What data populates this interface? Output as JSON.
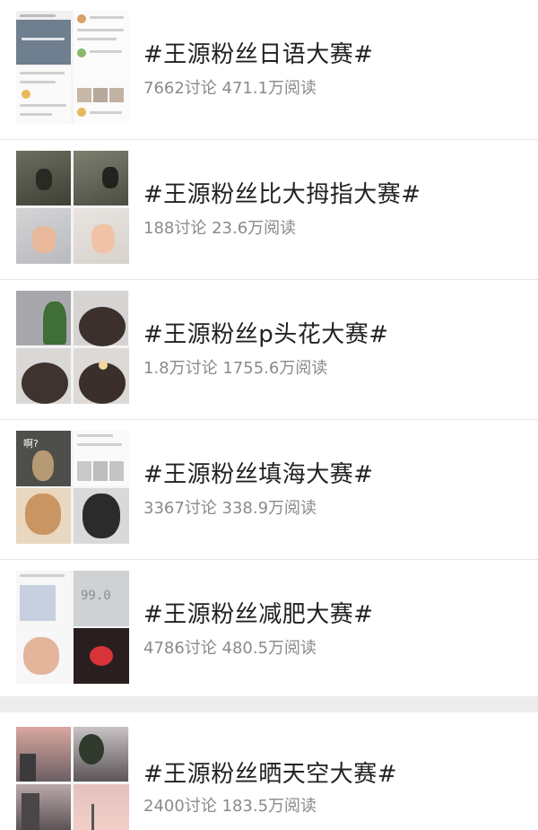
{
  "items": [
    {
      "title": "#王源粉丝日语大赛#",
      "stats": "7662讨论 471.1万阅读"
    },
    {
      "title": "#王源粉丝比大拇指大赛#",
      "stats": "188讨论 23.6万阅读"
    },
    {
      "title": "#王源粉丝p头花大赛#",
      "stats": "1.8万讨论 1755.6万阅读"
    },
    {
      "title": "#王源粉丝填海大赛#",
      "stats": "3367讨论 338.9万阅读"
    },
    {
      "title": "#王源粉丝减肥大赛#",
      "stats": "4786讨论 480.5万阅读"
    },
    {
      "title": "#王源粉丝晒天空大赛#",
      "stats": "2400讨论 183.5万阅读"
    }
  ],
  "thumbs": {
    "item4_tl_text": "啊?",
    "item5_tr_text": "99.0"
  }
}
